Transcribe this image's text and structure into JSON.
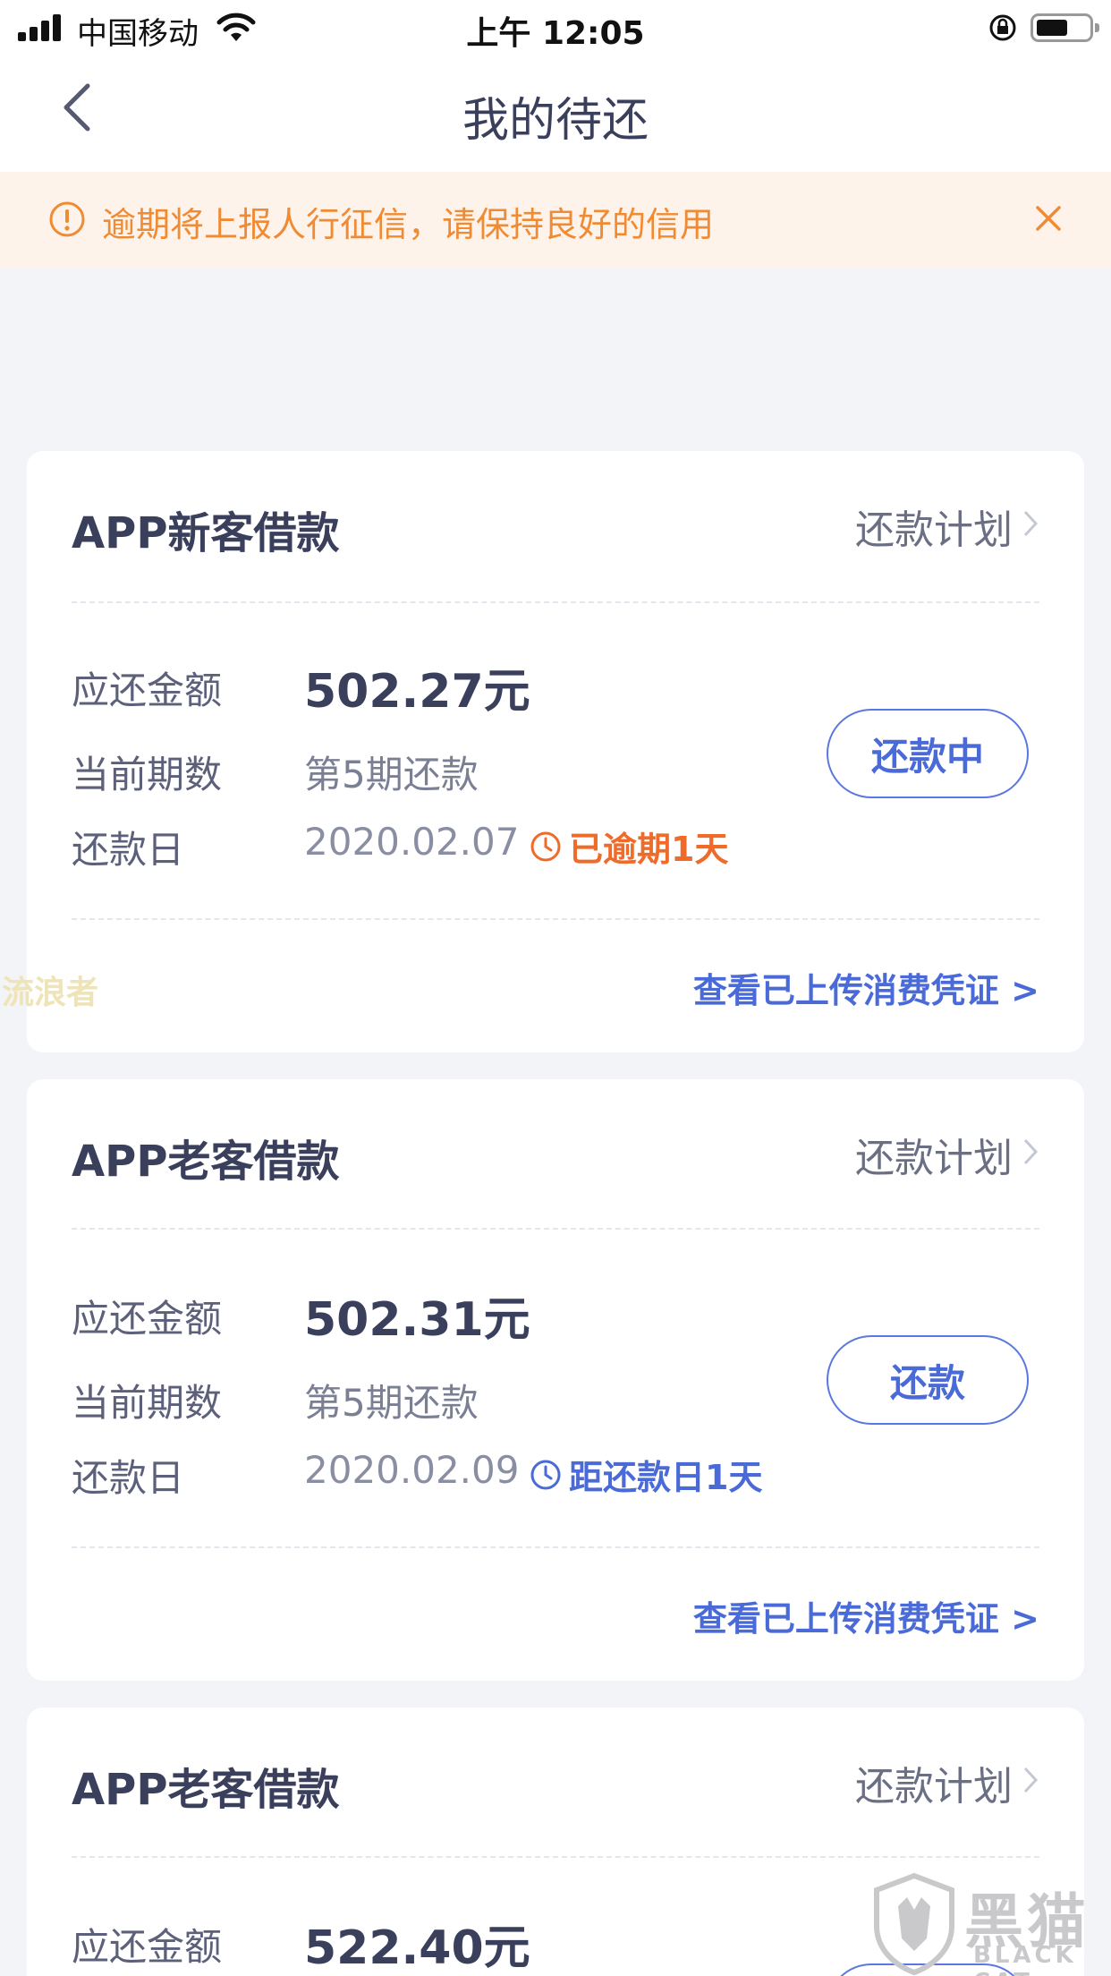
{
  "status_bar": {
    "carrier": "中国移动",
    "time": "上午 12:05",
    "battery_level": 0.6
  },
  "nav": {
    "title": "我的待还"
  },
  "notice": {
    "text": "逾期将上报人行征信，请保持良好的信用"
  },
  "loans": [
    {
      "title": "APP新客借款",
      "plan_link": "还款计划",
      "amount_label": "应还金额",
      "amount": "502.27元",
      "period_label": "当前期数",
      "period": "第5期还款",
      "date_label": "还款日",
      "date": "2020.02.07",
      "status_text": "已逾期1天",
      "status_color": "#ee6b2a",
      "button_label": "还款中",
      "voucher_link": "查看已上传消费凭证 >"
    },
    {
      "title": "APP老客借款",
      "plan_link": "还款计划",
      "amount_label": "应还金额",
      "amount": "502.31元",
      "period_label": "当前期数",
      "period": "第5期还款",
      "date_label": "还款日",
      "date": "2020.02.09",
      "status_text": "距还款日1天",
      "status_color": "#4a6ad8",
      "button_label": "还款",
      "voucher_link": "查看已上传消费凭证 >"
    },
    {
      "title": "APP老客借款",
      "plan_link": "还款计划",
      "amount_label": "应还金额",
      "amount": "522.40元"
    }
  ],
  "watermarks": {
    "left": "流浪者",
    "right_cn": "黑猫",
    "right_en": "BLACK CAT"
  },
  "colors": {
    "accent": "#4a6ad8",
    "warning": "#f08b34",
    "overdue": "#ee6b2a"
  }
}
